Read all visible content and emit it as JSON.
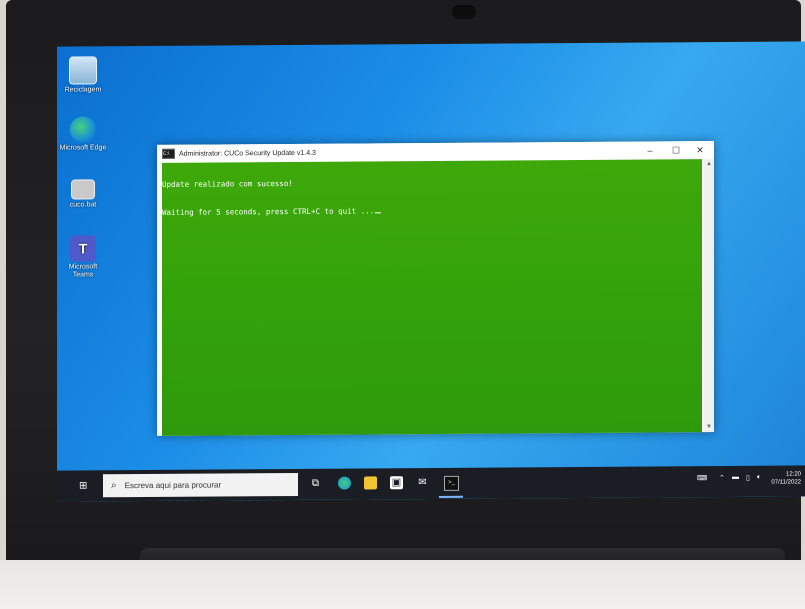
{
  "desktop": {
    "icons": [
      {
        "label": "Reciclagem",
        "icon": "recycle-bin-icon"
      },
      {
        "label": "Microsoft Edge",
        "icon": "edge-icon"
      },
      {
        "label": "cuco.bat",
        "icon": "batch-file-icon"
      },
      {
        "label": "Microsoft Teams",
        "icon": "teams-icon"
      }
    ]
  },
  "console": {
    "title": "Administrator: CUCo Security Update v1.4.3",
    "lines": [
      "Update realizado com sucesso!",
      "Waiting for 5 seconds, press CTRL+C to quit ..."
    ],
    "background": "#35a30a",
    "controls": {
      "minimize": "–",
      "maximize": "☐",
      "close": "✕"
    }
  },
  "taskbar": {
    "start_icon": "windows-logo-icon",
    "search_placeholder": "Escreva aqui para procurar",
    "pinned": [
      "task-view-icon",
      "edge-icon",
      "file-explorer-icon",
      "store-icon",
      "mail-icon",
      "command-prompt-icon"
    ],
    "time": "12:20",
    "date": "07/11/2022"
  }
}
